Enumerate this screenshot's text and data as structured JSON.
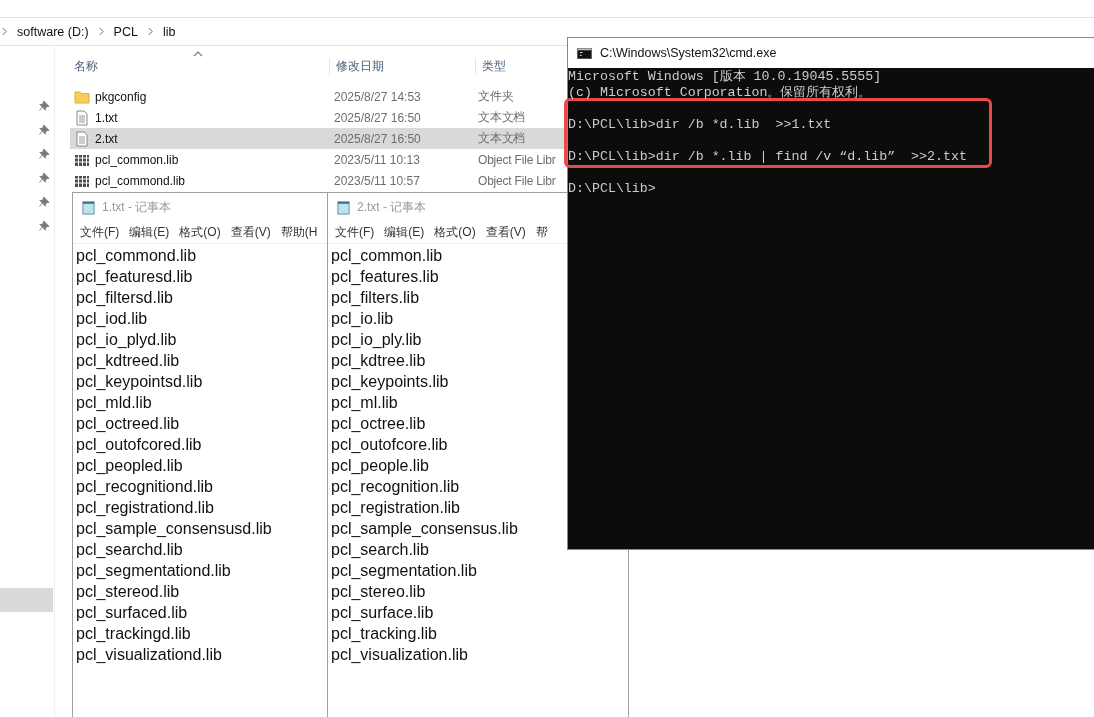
{
  "explorer": {
    "breadcrumb": [
      "software (D:)",
      "PCL",
      "lib"
    ],
    "columns": [
      "名称",
      "修改日期",
      "类型"
    ],
    "files": [
      {
        "name": "pkgconfig",
        "modified": "2025/8/27 14:53",
        "type": "文件夹",
        "kind": "folder",
        "selected": false
      },
      {
        "name": "1.txt",
        "modified": "2025/8/27 16:50",
        "type": "文本文档",
        "kind": "text",
        "selected": false
      },
      {
        "name": "2.txt",
        "modified": "2025/8/27 16:50",
        "type": "文本文档",
        "kind": "text",
        "selected": true
      },
      {
        "name": "pcl_common.lib",
        "modified": "2023/5/11 10:13",
        "type": "Object File Libr",
        "kind": "library",
        "selected": false
      },
      {
        "name": "pcl_commond.lib",
        "modified": "2023/5/11 10:57",
        "type": "Object File Libr",
        "kind": "library",
        "selected": false
      }
    ]
  },
  "notepads": [
    {
      "title": "1.txt - 记事本",
      "menu": [
        "文件(F)",
        "编辑(E)",
        "格式(O)",
        "查看(V)",
        "帮助(H"
      ],
      "lines": [
        "pcl_commond.lib",
        "pcl_featuresd.lib",
        "pcl_filtersd.lib",
        "pcl_iod.lib",
        "pcl_io_plyd.lib",
        "pcl_kdtreed.lib",
        "pcl_keypointsd.lib",
        "pcl_mld.lib",
        "pcl_octreed.lib",
        "pcl_outofcored.lib",
        "pcl_peopled.lib",
        "pcl_recognitiond.lib",
        "pcl_registrationd.lib",
        "pcl_sample_consensusd.lib",
        "pcl_searchd.lib",
        "pcl_segmentationd.lib",
        "pcl_stereod.lib",
        "pcl_surfaced.lib",
        "pcl_trackingd.lib",
        "pcl_visualizationd.lib"
      ]
    },
    {
      "title": "2.txt - 记事本",
      "menu": [
        "文件(F)",
        "编辑(E)",
        "格式(O)",
        "查看(V)",
        "帮"
      ],
      "lines": [
        "pcl_common.lib",
        "pcl_features.lib",
        "pcl_filters.lib",
        "pcl_io.lib",
        "pcl_io_ply.lib",
        "pcl_kdtree.lib",
        "pcl_keypoints.lib",
        "pcl_ml.lib",
        "pcl_octree.lib",
        "pcl_outofcore.lib",
        "pcl_people.lib",
        "pcl_recognition.lib",
        "pcl_registration.lib",
        "pcl_sample_consensus.lib",
        "pcl_search.lib",
        "pcl_segmentation.lib",
        "pcl_stereo.lib",
        "pcl_surface.lib",
        "pcl_tracking.lib",
        "pcl_visualization.lib"
      ]
    }
  ],
  "console": {
    "title": "C:\\Windows\\System32\\cmd.exe",
    "blocks": [
      {
        "lines": [
          "Microsoft Windows [版本 10.0.19045.5555]",
          "(c) Microsoft Corporation。保留所有权利。"
        ],
        "highlighted": false
      },
      {
        "lines": [
          "D:\\PCL\\lib>dir /b *d.lib  >>1.txt",
          "D:\\PCL\\lib>dir /b *.lib | find /v “d.lib”  >>2.txt"
        ],
        "highlighted": true
      },
      {
        "lines": [
          "D:\\PCL\\lib>"
        ],
        "highlighted": false
      }
    ]
  }
}
